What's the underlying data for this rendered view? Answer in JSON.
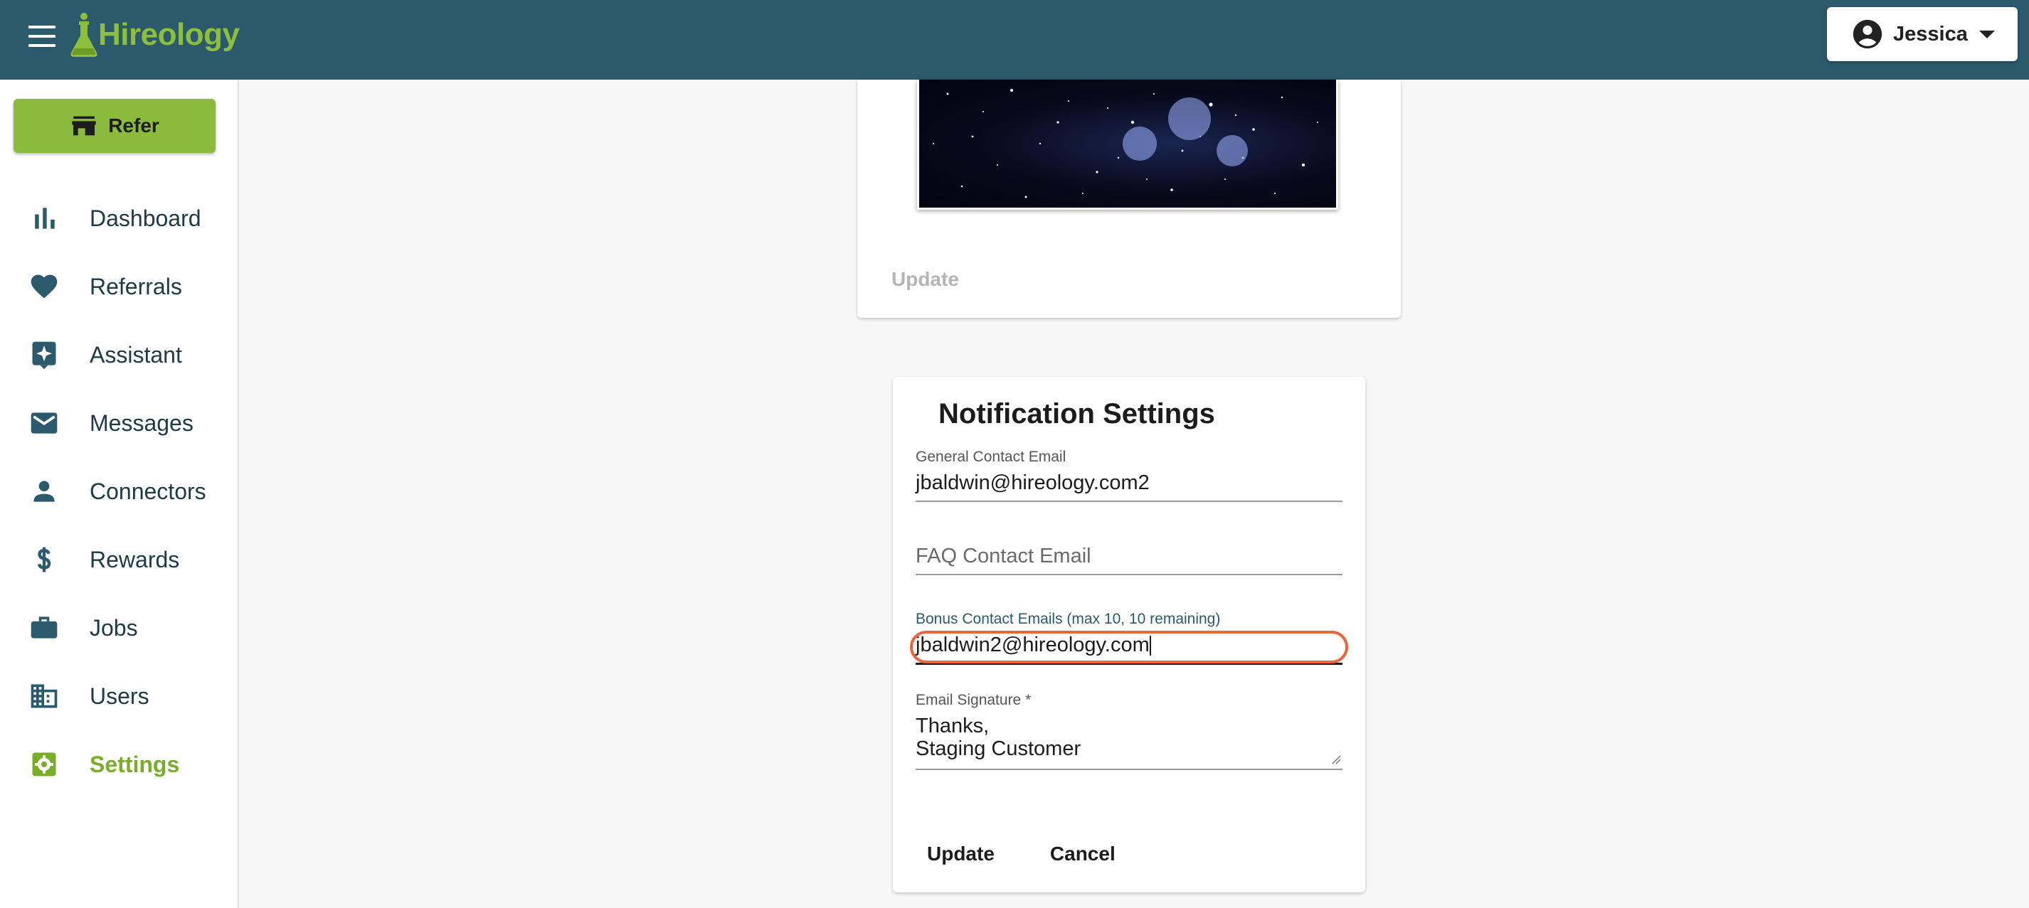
{
  "app": {
    "brand": "Hireology",
    "brand_color": "#8dbf3c",
    "header_color": "#2b5a6c"
  },
  "header": {
    "user_name": "Jessica"
  },
  "sidebar": {
    "refer_label": "Refer",
    "items": [
      {
        "label": "Dashboard",
        "icon": "bar-chart-icon"
      },
      {
        "label": "Referrals",
        "icon": "heart-icon"
      },
      {
        "label": "Assistant",
        "icon": "sparkle-icon"
      },
      {
        "label": "Messages",
        "icon": "envelope-icon"
      },
      {
        "label": "Connectors",
        "icon": "person-icon"
      },
      {
        "label": "Rewards",
        "icon": "dollar-icon"
      },
      {
        "label": "Jobs",
        "icon": "briefcase-icon"
      },
      {
        "label": "Users",
        "icon": "building-icon"
      },
      {
        "label": "Settings",
        "icon": "gear-icon",
        "active": true
      }
    ]
  },
  "image_card": {
    "update_label": "Update"
  },
  "notification_settings": {
    "title": "Notification Settings",
    "general_contact": {
      "label": "General Contact Email",
      "value": "jbaldwin@hireology.com2"
    },
    "faq_contact": {
      "placeholder": "FAQ Contact Email"
    },
    "bonus_contact": {
      "label": "Bonus Contact Emails (max 10, 10 remaining)",
      "value": "jbaldwin2@hireology.com"
    },
    "signature": {
      "label": "Email Signature *",
      "line1": "Thanks,",
      "line2": "Staging Customer"
    },
    "update_label": "Update",
    "cancel_label": "Cancel"
  }
}
